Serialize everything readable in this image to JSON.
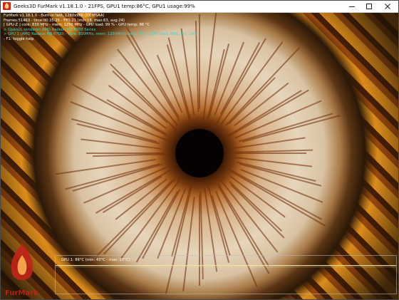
{
  "window": {
    "title": "Geeks3D FurMark v1.18.1.0 - 21FPS, GPU1 temp:86°C, GPU1 usage:99%",
    "icons": {
      "app": "furmark-app-icon",
      "minimize": "minimize-icon",
      "maximize": "maximize-icon",
      "close": "close-icon"
    }
  },
  "overlay": {
    "lines": [
      {
        "text": "FurMark v1.18.1.0 - Burn-in test, 1280x960 (0X MSAA)",
        "color": "#ffffff"
      },
      {
        "text": "Frames:51463 - time:00:35:25 - FPS:21 (min:18, max:63, avg:24)",
        "color": "#ffffff"
      },
      {
        "text": "[ GPU-Z ] core: 830 MHz - mem: 1250 MHz - GPU load: 99 % - GPU temp: 86 °C",
        "color": "#ffffff"
      },
      {
        "text": "> OpenGL renderer: AMD Radeon HD 6700 Series",
        "color": "#39d7d0"
      },
      {
        "text": "> GPU 1 (AMD Radeon HD 6700) - core: 830MHz, mem: 1250MHz, temp: 87°C, GPU load: 99%, fan: 19%",
        "color": "#39d7d0"
      },
      {
        "text": "- F1: toggle help",
        "color": "#ffffff"
      }
    ]
  },
  "graph": {
    "label": "GPU 1: 86°C (min: 43°C - max: 87°C)"
  },
  "logo": {
    "text": "FurMark"
  },
  "colors": {
    "fur_orange": "#f29a1e",
    "iris_light": "#e6d5bb",
    "overlay_cyan": "#39d7d0",
    "graph_line": "#f4e3a8"
  }
}
